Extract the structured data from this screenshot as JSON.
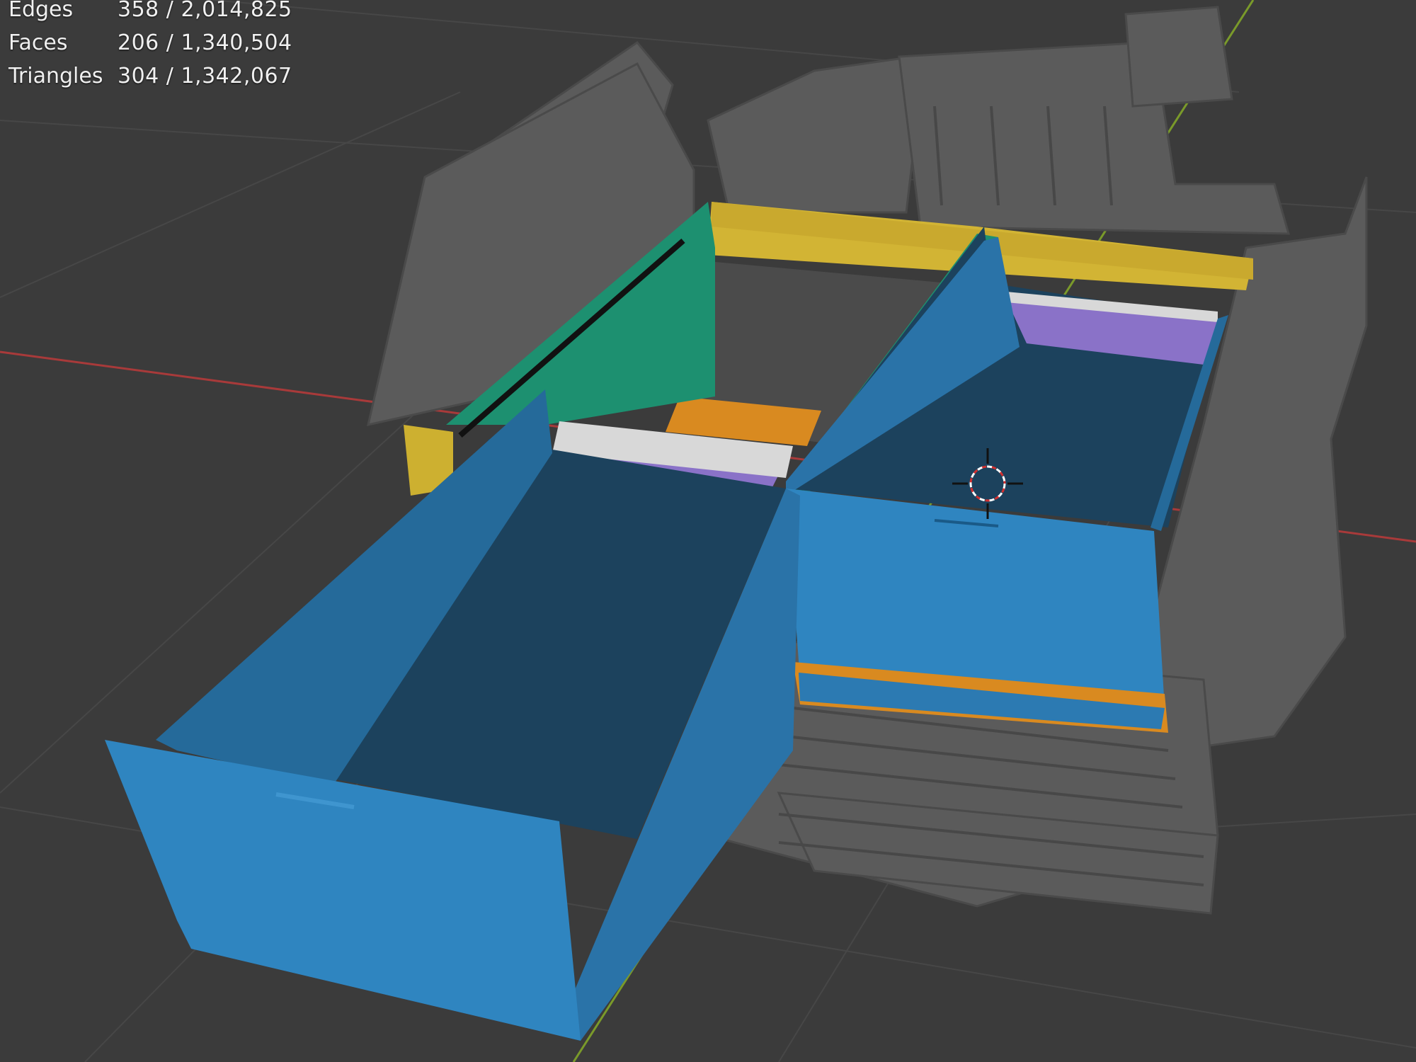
{
  "overlay": {
    "stats": [
      {
        "label": "Edges",
        "value": "358 / 2,014,825"
      },
      {
        "label": "Faces",
        "value": "206 / 1,340,504"
      },
      {
        "label": "Triangles",
        "value": "304 / 1,342,067"
      }
    ]
  },
  "colors": {
    "viewport_bg": "#3b3b3b",
    "grid": "#4a4a4a",
    "x_axis": "#a83a3a",
    "y_axis": "#7a9a2a",
    "scan_mesh": "#5a5a5a",
    "drawer_front": "#2f85c0",
    "drawer_side": "#256a9a",
    "drawer_inside": "#1a3e57",
    "rail": "#1d9070",
    "back_panel": "#d2b434",
    "divider": "#d8d8d8",
    "purple_panel": "#8a72c8",
    "floor_orange": "#d98a20"
  },
  "icons": {
    "cursor": "3d-cursor-icon"
  }
}
